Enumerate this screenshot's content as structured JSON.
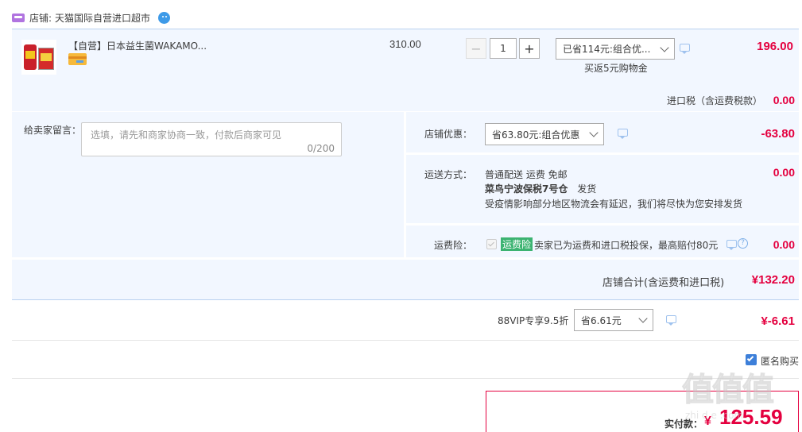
{
  "shop": {
    "label": "店铺:",
    "name": "天猫国际自营进口超市",
    "chat_icon": "wangwang-chat-icon"
  },
  "item": {
    "title": "【自营】日本益生菌WAKAMO...",
    "unit_price": "310.00",
    "qty_minus": "−",
    "qty": "1",
    "qty_plus": "+",
    "promo_select": "已省114元:组合优...",
    "cashback": "买返5元购物金",
    "subtotal": "196.00"
  },
  "tax": {
    "label": "进口税（含运费税款）",
    "value": "0.00"
  },
  "message": {
    "label": "给卖家留言：",
    "placeholder": "选填，请先和商家协商一致，付款后商家可见",
    "counter": "0/200"
  },
  "discount": {
    "label": "店铺优惠：",
    "select": "省63.80元:组合优惠",
    "value": "-63.80"
  },
  "shipping": {
    "label": "运送方式：",
    "line1": "普通配送 运费 免邮",
    "line2_bold": "菜鸟宁波保税7号仓",
    "line2_rest": "发货",
    "line3": "受疫情影响部分地区物流会有延迟，我们将尽快为您安排发货",
    "value": "0.00"
  },
  "insurance": {
    "label": "运费险：",
    "badge": "运费险",
    "text": "卖家已为运费和进口税投保，最高赔付80元",
    "value": "0.00"
  },
  "shop_total": {
    "label": "店铺合计(含运费和进口税)",
    "value": "¥132.20"
  },
  "vip": {
    "label": "88VIP专享9.5折",
    "select": "省6.61元",
    "value": "¥-6.61"
  },
  "anonymous": {
    "label": "匿名购买",
    "checked": true
  },
  "pay": {
    "label": "实付款：",
    "currency": "¥",
    "value": "125.59"
  },
  "watermark": {
    "text": "值值值",
    "sub": "zhi d e  .com"
  },
  "colors": {
    "accent_red": "#e4003f",
    "panel_blue": "#f2f7ff",
    "badge_green": "#3cb371",
    "checkbox_blue": "#3d7fd9"
  }
}
